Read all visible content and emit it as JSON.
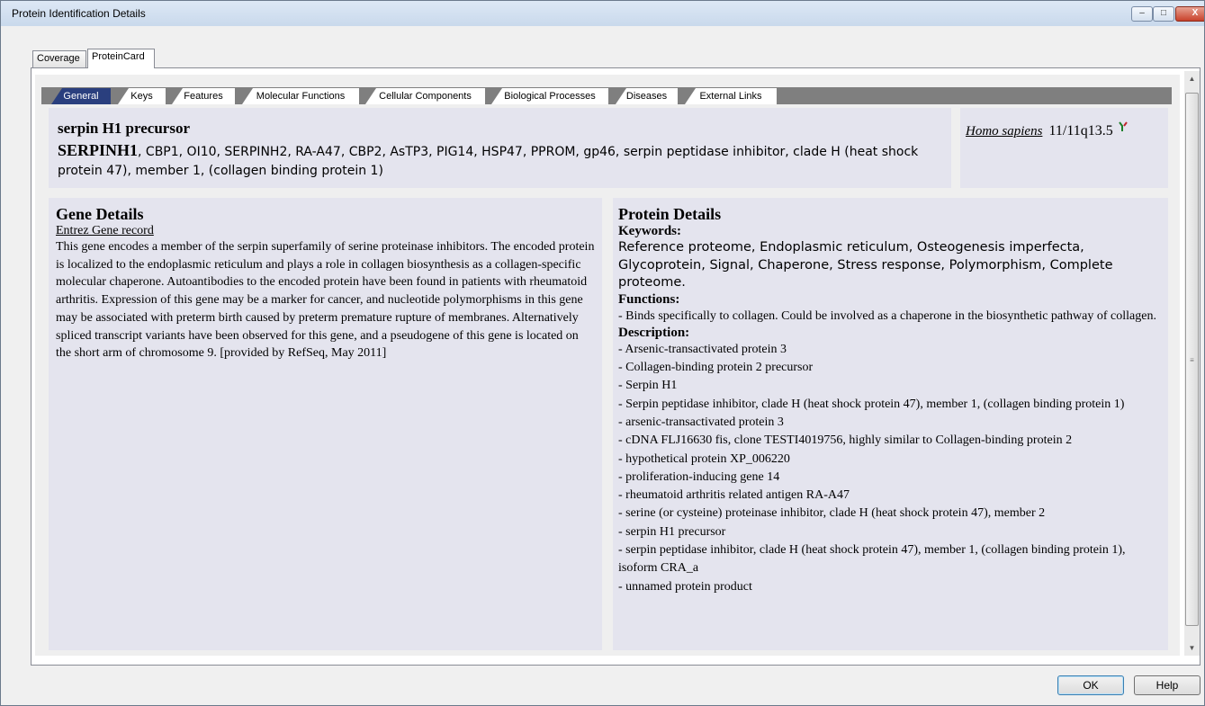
{
  "window": {
    "title": "Protein Identification Details",
    "controls": {
      "minimize": "–",
      "maximize": "□",
      "close": "X"
    }
  },
  "outer_tabs": [
    {
      "label": "Coverage",
      "active": false
    },
    {
      "label": "ProteinCard",
      "active": true
    }
  ],
  "inner_tabs": [
    {
      "label": "General",
      "active": true
    },
    {
      "label": "Keys",
      "active": false
    },
    {
      "label": "Features",
      "active": false
    },
    {
      "label": "Molecular Functions",
      "active": false
    },
    {
      "label": "Cellular Components",
      "active": false
    },
    {
      "label": "Biological Processes",
      "active": false
    },
    {
      "label": "Diseases",
      "active": false
    },
    {
      "label": "External Links",
      "active": false
    }
  ],
  "header": {
    "protein_name": "serpin H1 precursor",
    "gene_symbol": "SERPINH1",
    "aliases": ", CBP1, OI10, SERPINH2, RA-A47, CBP2, AsTP3, PIG14, HSP47, PPROM, gp46, serpin peptidase inhibitor, clade H (heat shock protein 47), member 1, (collagen binding protein 1)",
    "organism": "Homo sapiens",
    "location": "11/11q13.5",
    "chromosome_icon": "chromosome-icon"
  },
  "gene_details": {
    "title": "Gene Details",
    "link": "Entrez Gene record",
    "text": "This gene encodes a member of the serpin superfamily of serine proteinase inhibitors. The encoded protein is localized to the endoplasmic reticulum and plays a role in collagen biosynthesis as a collagen-specific molecular chaperone. Autoantibodies to the encoded protein have been found in patients with rheumatoid arthritis. Expression of this gene may be a marker for cancer, and nucleotide polymorphisms in this gene may be associated with preterm birth caused by preterm premature rupture of membranes. Alternatively spliced transcript variants have been observed for this gene, and a pseudogene of this gene is located on the short arm of chromosome 9. [provided by RefSeq, May 2011]"
  },
  "protein_details": {
    "title": "Protein Details",
    "keywords_label": "Keywords:",
    "keywords": "Reference proteome, Endoplasmic reticulum, Osteogenesis imperfecta, Glycoprotein, Signal, Chaperone, Stress response, Polymorphism, Complete proteome.",
    "functions_label": "Functions:",
    "functions": "- Binds specifically to collagen. Could be involved as a chaperone in the biosynthetic pathway of collagen.",
    "description_label": "Description:",
    "descriptions": [
      "- Arsenic-transactivated protein 3",
      "- Collagen-binding protein 2 precursor",
      "- Serpin H1",
      "- Serpin peptidase inhibitor, clade H (heat shock protein 47), member 1, (collagen binding protein 1)",
      "- arsenic-transactivated protein 3",
      "- cDNA FLJ16630 fis, clone TESTI4019756, highly similar to Collagen-binding protein 2",
      "- hypothetical protein XP_006220",
      "- proliferation-inducing gene 14",
      "- rheumatoid arthritis related antigen RA-A47",
      "- serine (or cysteine) proteinase inhibitor, clade H (heat shock protein 47), member 2",
      "- serpin H1 precursor",
      "- serpin peptidase inhibitor, clade H (heat shock protein 47), member 1, (collagen binding protein 1), isoform CRA_a",
      "- unnamed protein product"
    ]
  },
  "scrollbar": {
    "up": "▲",
    "down": "▼",
    "grip": "≡"
  },
  "buttons": {
    "ok": "OK",
    "help": "Help"
  }
}
